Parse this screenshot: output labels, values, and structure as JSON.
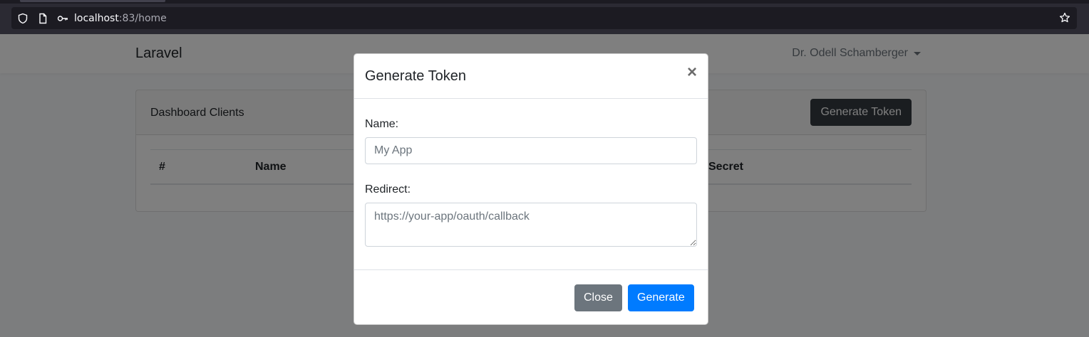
{
  "browser": {
    "url_host": "localhost",
    "url_rest": ":83/home"
  },
  "navbar": {
    "brand": "Laravel",
    "user": "Dr. Odell Schamberger"
  },
  "card": {
    "title": "Dashboard Clients",
    "generate_label": "Generate Token",
    "columns": [
      "#",
      "Name",
      "Secret"
    ]
  },
  "modal": {
    "title": "Generate Token",
    "close_symbol": "×",
    "name_label": "Name:",
    "name_placeholder": "My App",
    "redirect_label": "Redirect:",
    "redirect_placeholder": "https://your-app/oauth/callback",
    "close_button": "Close",
    "generate_button": "Generate"
  },
  "icons": [
    "shield-icon",
    "page-icon",
    "key-icon",
    "star-icon"
  ]
}
